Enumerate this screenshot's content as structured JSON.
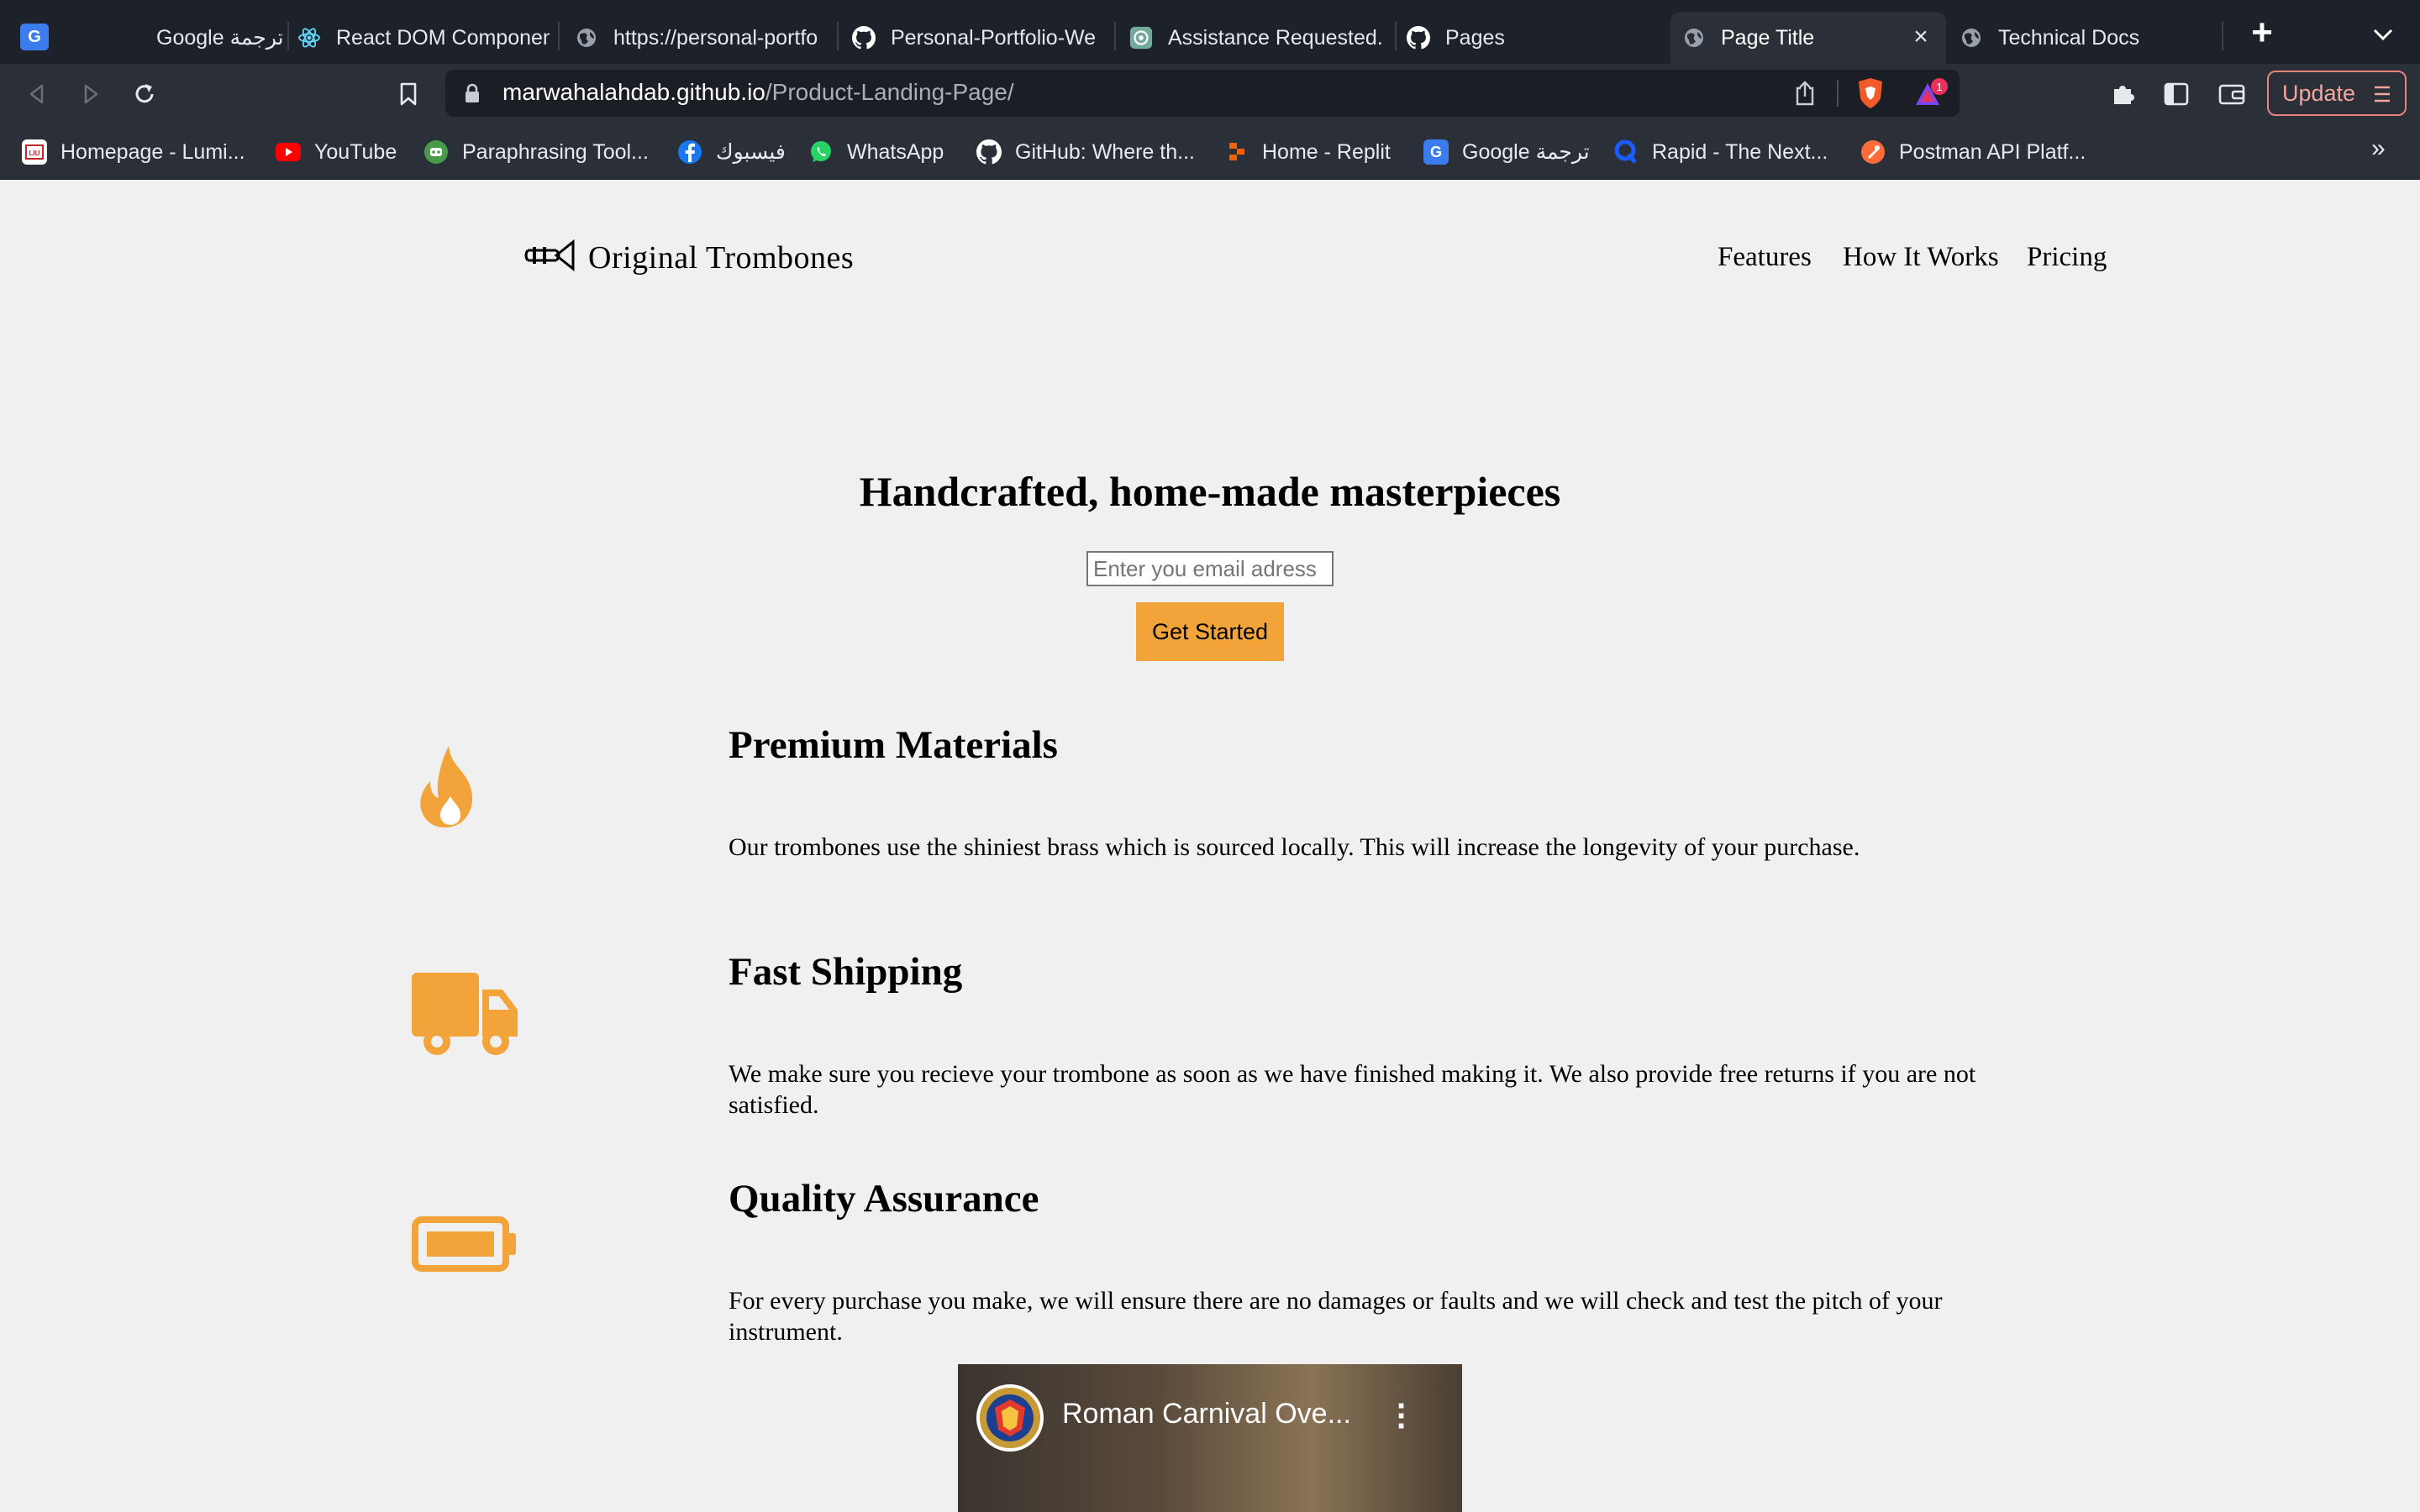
{
  "browser": {
    "tabs": [
      {
        "title": "Google ترجمة",
        "icon": "google-translate-icon"
      },
      {
        "title": "React DOM Componen",
        "icon": "react-icon"
      },
      {
        "title": "https://personal-portfo",
        "icon": "globe-icon"
      },
      {
        "title": "Personal-Portfolio-We",
        "icon": "github-icon"
      },
      {
        "title": "Assistance Requested.",
        "icon": "chatgpt-icon"
      },
      {
        "title": "Pages",
        "icon": "github-icon"
      },
      {
        "title": "Page Title",
        "icon": "globe-icon",
        "active": true
      },
      {
        "title": "Technical Docs",
        "icon": "globe-icon"
      }
    ],
    "url": {
      "host": "marwahalahdab.github.io",
      "path": "/Product-Landing-Page/"
    },
    "update_label": "Update",
    "bookmarks": [
      {
        "label": "Homepage - Lumi...",
        "icon": "lumi-icon"
      },
      {
        "label": "YouTube",
        "icon": "youtube-icon"
      },
      {
        "label": "Paraphrasing Tool...",
        "icon": "quillbot-icon"
      },
      {
        "label": "فيسبوك",
        "icon": "facebook-icon"
      },
      {
        "label": "WhatsApp",
        "icon": "whatsapp-icon"
      },
      {
        "label": "GitHub: Where th...",
        "icon": "github-icon"
      },
      {
        "label": "Home - Replit",
        "icon": "replit-icon"
      },
      {
        "label": "Google ترجمة",
        "icon": "google-translate-icon"
      },
      {
        "label": "Rapid - The Next...",
        "icon": "rapid-icon"
      },
      {
        "label": "Postman API Platf...",
        "icon": "postman-icon"
      }
    ],
    "bookmarks_overflow": "»"
  },
  "site": {
    "brand": "Original Trombones",
    "nav": [
      "Features",
      "How It Works",
      "Pricing"
    ],
    "hero": {
      "title": "Handcrafted, home-made masterpieces",
      "email_placeholder": "Enter you email adress",
      "cta_label": "Get Started"
    },
    "features": [
      {
        "icon": "fire-icon",
        "title": "Premium Materials",
        "desc": "Our trombones use the shiniest brass which is sourced locally. This will increase the longevity of your purchase."
      },
      {
        "icon": "truck-icon",
        "title": "Fast Shipping",
        "desc": "We make sure you recieve your trombone as soon as we have finished making it. We also provide free returns if you are not satisfied."
      },
      {
        "icon": "battery-icon",
        "title": "Quality Assurance",
        "desc": "For every purchase you make, we will ensure there are no damages or faults and we will check and test the pitch of your instrument."
      }
    ],
    "video": {
      "title": "Roman Carnival Ove..."
    }
  },
  "colors": {
    "accent": "#f2a43a",
    "chrome_dark": "#1d2129",
    "chrome": "#2a2f38",
    "page_bg": "#f0f0f0"
  }
}
